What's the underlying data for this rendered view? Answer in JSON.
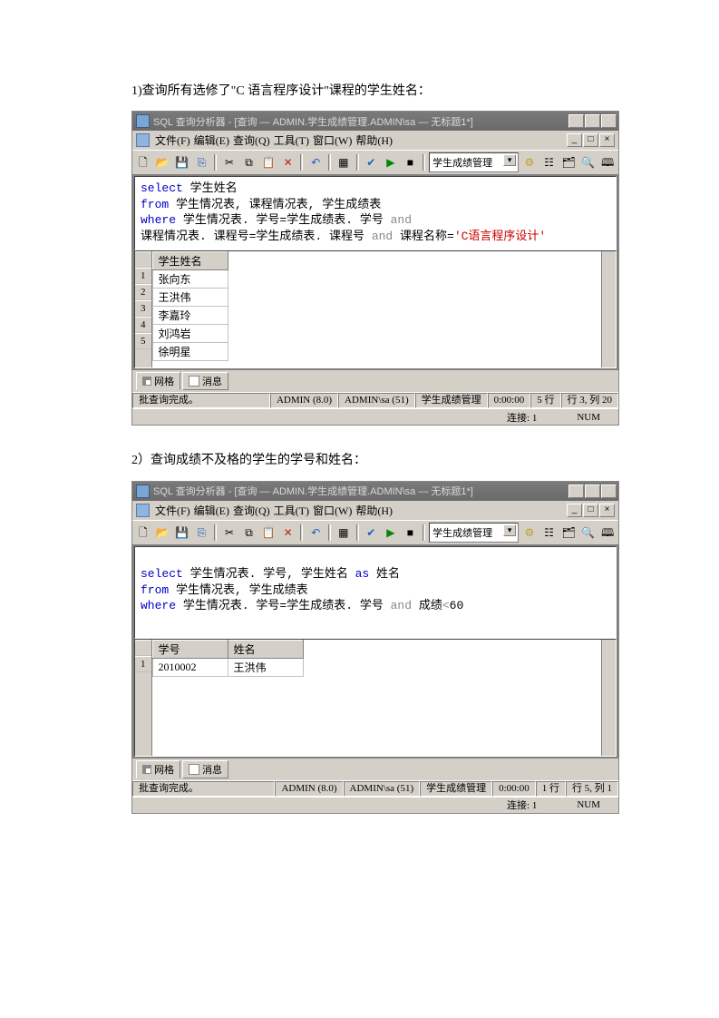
{
  "q1": {
    "text": "1)查询所有选修了\"C 语言程序设计\"课程的学生姓名：",
    "title": "SQL 查询分析器 - [查询 — ADMIN.学生成绩管理.ADMIN\\sa — 无标题1*]",
    "menu": [
      "文件(F)",
      "编辑(E)",
      "查询(Q)",
      "工具(T)",
      "窗口(W)",
      "帮助(H)"
    ],
    "combo": "学生成绩管理",
    "sql": {
      "l1a": "select",
      "l1b": " 学生姓名",
      "l2a": "from",
      "l2b": " 学生情况表, 课程情况表, 学生成绩表",
      "l3a": "where",
      "l3b": " 学生情况表. 学号=学生成绩表. 学号 ",
      "l3c": "and",
      "l4a": "课程情况表. 课程号=学生成绩表. 课程号 ",
      "l4b": "and",
      "l4c": " 课程名称=",
      "l4d": "'C语言程序设计'"
    },
    "cols": [
      "学生姓名"
    ],
    "rows": [
      [
        "张向东"
      ],
      [
        "王洪伟"
      ],
      [
        "李嘉玲"
      ],
      [
        "刘鸿岩"
      ],
      [
        "徐明星"
      ]
    ],
    "tabs": [
      "网格",
      "消息"
    ],
    "status": {
      "a": "批查询完成。",
      "b": "ADMIN (8.0)",
      "c": "ADMIN\\sa (51)",
      "d": "学生成绩管理",
      "e": "0:00:00",
      "f": "5 行",
      "g": "行 3, 列 20"
    },
    "status2": {
      "a": "连接: 1",
      "b": "NUM"
    }
  },
  "q2": {
    "text": "2）查询成绩不及格的学生的学号和姓名：",
    "title": "SQL 查询分析器 - [查询 — ADMIN.学生成绩管理.ADMIN\\sa — 无标题1*]",
    "menu": [
      "文件(F)",
      "编辑(E)",
      "查询(Q)",
      "工具(T)",
      "窗口(W)",
      "帮助(H)"
    ],
    "combo": "学生成绩管理",
    "sql": {
      "l1a": "select",
      "l1b": " 学生情况表. 学号, 学生姓名 ",
      "l1c": "as",
      "l1d": " 姓名",
      "l2a": "from",
      "l2b": " 学生情况表, 学生成绩表",
      "l3a": "where",
      "l3b": " 学生情况表. 学号=学生成绩表. 学号 ",
      "l3c": "and",
      "l3d": " 成绩",
      "l3e": "<",
      "l3f": "60"
    },
    "cols": [
      "学号",
      "姓名"
    ],
    "rows": [
      [
        "2010002",
        "王洪伟"
      ]
    ],
    "tabs": [
      "网格",
      "消息"
    ],
    "status": {
      "a": "批查询完成。",
      "b": "ADMIN (8.0)",
      "c": "ADMIN\\sa (51)",
      "d": "学生成绩管理",
      "e": "0:00:00",
      "f": "1 行",
      "g": "行 5, 列 1"
    },
    "status2": {
      "a": "连接: 1",
      "b": "NUM"
    }
  },
  "winbtns": {
    "min": "_",
    "max": "□",
    "close": "×"
  }
}
